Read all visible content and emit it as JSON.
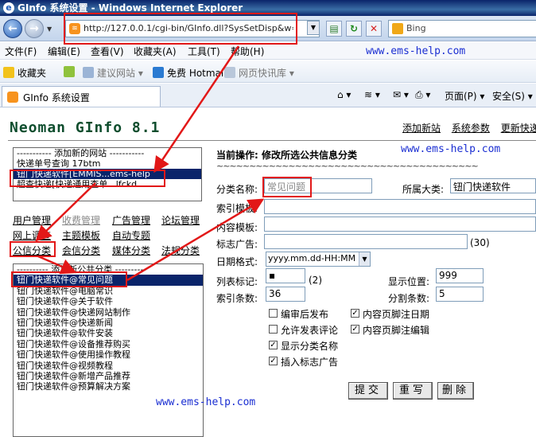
{
  "window": {
    "title": "GInfo 系统设置 - Windows Internet Explorer"
  },
  "navbar": {
    "address": "http://127.0.0.1/cgi-bin/GInfo.dll?SysSetDisp&w=ems-help",
    "search_placeholder": "Bing"
  },
  "menubar": [
    "文件(F)",
    "编辑(E)",
    "查看(V)",
    "收藏夹(A)",
    "工具(T)",
    "帮助(H)"
  ],
  "favbar": {
    "favorites": "收藏夹",
    "suggested": "建议网站 ▾",
    "hotmail": "免费 Hotmail",
    "webslice": "网页快讯库 ▾"
  },
  "tab": {
    "title": "GInfo 系统设置"
  },
  "commandbar": {
    "page": "页面(P) ▾",
    "safety": "安全(S) ▾"
  },
  "watermark": "www.ems-help.com",
  "page": {
    "brand": "Neoman GInfo 8.1",
    "toplinks": [
      "添加新站",
      "系统参数",
      "更新快递"
    ],
    "site_list": [
      "----------- 添加新的网站 -----------",
      "快递单号查询      17btm",
      "钮门快递软件[EMMIS...ems-help",
      "    超查快递[快递通用查单...lfckd"
    ],
    "nav": {
      "row1": [
        "用户管理",
        "收费管理",
        "广告管理",
        "论坛管理"
      ],
      "row2": [
        "网上调查",
        "主题模板",
        "自动专题"
      ],
      "row3": [
        "公信分类",
        "会信分类",
        "媒体分类",
        "法规分类"
      ]
    },
    "category_list": [
      "---------- 添加新公共分类 ----------",
      "钮门快递软件@常见问题",
      "钮门快递软件@电脑常识",
      "钮门快递软件@关于软件",
      "钮门快递软件@快递网站制作",
      "钮门快递软件@快递新闻",
      "钮门快递软件@软件安装",
      "钮门快递软件@设备推荐购买",
      "钮门快递软件@使用操作教程",
      "钮门快递软件@视频教程",
      "钮门快递软件@新增产品推荐",
      "钮门快递软件@预算解决方案"
    ],
    "form": {
      "operation": "当前操作: 修改所选公共信息分类",
      "tilde": "~~~~~~~~~~~~~~~~~~~~~~~~~~~~~~~~~~~~~~~~",
      "name_label": "分类名称:",
      "name_value": "常见问题",
      "parent_label": "所属大类:",
      "parent_value": "钮门快递软件",
      "index_tpl_label": "索引模板:",
      "content_tpl_label": "内容模板:",
      "ad_label": "标志广告:",
      "ad_hint": "(30)",
      "date_label": "日期格式:",
      "date_value": "yyyy.mm.dd-HH:MM",
      "list_mark_label": "列表标记:",
      "list_mark_value": "▪",
      "list_mark_hint": "(2)",
      "display_pos_label": "显示位置:",
      "display_pos_value": "999",
      "index_count_label": "索引条数:",
      "index_count_value": "36",
      "split_count_label": "分割条数:",
      "split_count_value": "5",
      "checkboxes": [
        {
          "label": "编审后发布",
          "checked": false
        },
        {
          "label": "内容页脚注日期",
          "checked": true
        },
        {
          "label": "允许发表评论",
          "checked": false
        },
        {
          "label": "内容页脚注编辑",
          "checked": true
        },
        {
          "label": "显示分类名称",
          "checked": true
        },
        {
          "label": "插入标志广告",
          "checked": true
        }
      ],
      "buttons": {
        "submit": "提交",
        "rewrite": "重写",
        "delete": "删除"
      }
    }
  },
  "colors": {
    "annotation": "#e21818",
    "watermark": "#1a2ed2",
    "selection": "#0a246a"
  }
}
